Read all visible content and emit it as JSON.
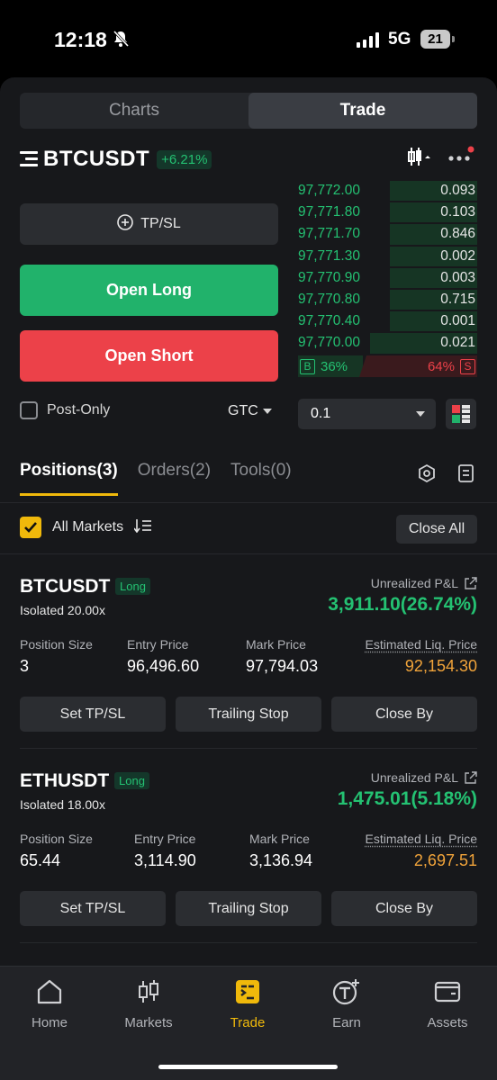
{
  "status": {
    "time": "12:18",
    "network": "5G",
    "battery": "21"
  },
  "segment": {
    "charts": "Charts",
    "trade": "Trade"
  },
  "pair": {
    "symbol": "BTCUSDT",
    "change": "+6.21%"
  },
  "actions": {
    "tpsl": "TP/SL",
    "open_long": "Open Long",
    "open_short": "Open Short"
  },
  "order_options": {
    "post_only": "Post-Only",
    "tif": "GTC",
    "quantity": "0.1"
  },
  "orderbook": {
    "rows": [
      {
        "price": "97,772.00",
        "qty": "0.093",
        "depth": 0.49
      },
      {
        "price": "97,771.80",
        "qty": "0.103",
        "depth": 0.49
      },
      {
        "price": "97,771.70",
        "qty": "0.846",
        "depth": 0.49
      },
      {
        "price": "97,771.30",
        "qty": "0.002",
        "depth": 0.49
      },
      {
        "price": "97,770.90",
        "qty": "0.003",
        "depth": 0.49
      },
      {
        "price": "97,770.80",
        "qty": "0.715",
        "depth": 0.49
      },
      {
        "price": "97,770.40",
        "qty": "0.001",
        "depth": 0.49
      },
      {
        "price": "97,770.00",
        "qty": "0.021",
        "depth": 0.6
      }
    ],
    "buy_tag": "B",
    "buy_pct": "36%",
    "sell_pct": "64%",
    "sell_tag": "S"
  },
  "tabs": {
    "positions": "Positions(3)",
    "orders": "Orders(2)",
    "tools": "Tools(0)"
  },
  "filter": {
    "all_markets": "All Markets",
    "close_all": "Close All"
  },
  "positions": [
    {
      "symbol": "BTCUSDT",
      "side": "Long",
      "leverage": "Isolated 20.00x",
      "upnl_label": "Unrealized P&L",
      "upnl": "3,911.10(26.74%)",
      "size_label": "Position Size",
      "size": "3",
      "entry_label": "Entry Price",
      "entry": "96,496.60",
      "mark_label": "Mark Price",
      "mark": "97,794.03",
      "liq_label": "Estimated Liq. Price",
      "liq": "92,154.30",
      "btn_tpsl": "Set TP/SL",
      "btn_trailing": "Trailing Stop",
      "btn_close": "Close By"
    },
    {
      "symbol": "ETHUSDT",
      "side": "Long",
      "leverage": "Isolated 18.00x",
      "upnl_label": "Unrealized P&L",
      "upnl": "1,475.01(5.18%)",
      "size_label": "Position Size",
      "size": "65.44",
      "entry_label": "Entry Price",
      "entry": "3,114.90",
      "mark_label": "Mark Price",
      "mark": "3,136.94",
      "liq_label": "Estimated Liq. Price",
      "liq": "2,697.51",
      "btn_tpsl": "Set TP/SL",
      "btn_trailing": "Trailing Stop",
      "btn_close": "Close By"
    }
  ],
  "nav": {
    "home": "Home",
    "markets": "Markets",
    "trade": "Trade",
    "earn": "Earn",
    "assets": "Assets"
  },
  "colors": {
    "accent": "#f0b90b",
    "buy": "#21b26b",
    "sell": "#ec4149",
    "liq": "#f0a33a"
  }
}
